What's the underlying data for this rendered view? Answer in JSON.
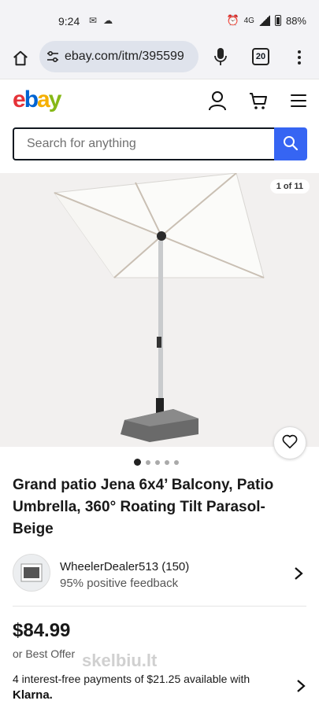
{
  "status_bar": {
    "time": "9:24",
    "network": "4G",
    "battery": "88%"
  },
  "browser": {
    "url": "ebay.com/itm/395599",
    "tabs_count": "20"
  },
  "header": {
    "logo": {
      "e": "e",
      "b": "b",
      "a": "a",
      "y": "y"
    }
  },
  "search": {
    "placeholder": "Search for anything"
  },
  "gallery": {
    "counter": "1 of 11",
    "dots_count": 5,
    "active_dot": 0
  },
  "product": {
    "title": "Grand patio Jena 6x4’ Balcony, Patio Umbrella, 360° Roating Tilt Parasol-Beige",
    "price": "$84.99",
    "best_offer": "or Best Offer",
    "installment_text": "4 interest-free payments of $21.25 available with",
    "installment_provider": "Klarna."
  },
  "seller": {
    "name": "WheelerDealer513 (150)",
    "feedback": "95% positive feedback"
  },
  "watermark": "skelbiu.lt",
  "colors": {
    "search_button": "#3665f3",
    "logo_e": "#e53238",
    "logo_b": "#0064d2",
    "logo_a": "#f5af02",
    "logo_y": "#86b817"
  }
}
